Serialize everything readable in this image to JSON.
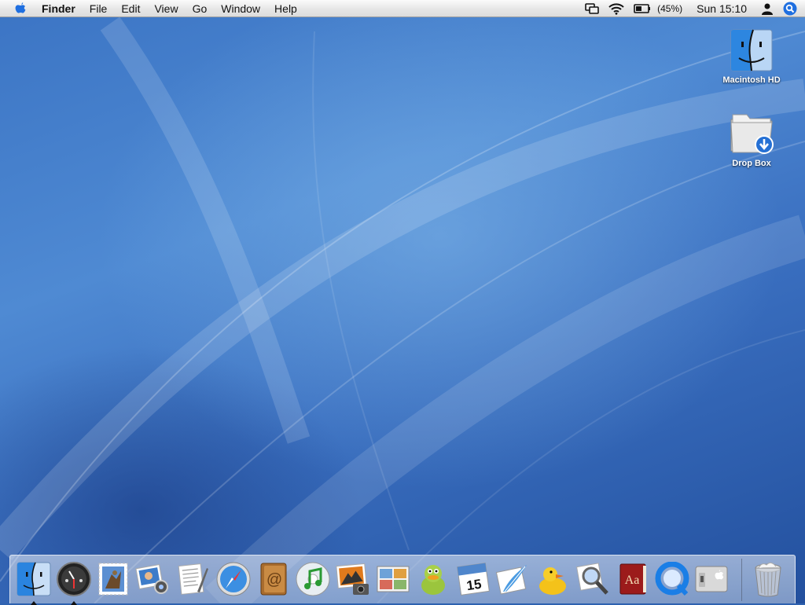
{
  "menubar": {
    "app_name": "Finder",
    "menus": [
      "File",
      "Edit",
      "View",
      "Go",
      "Window",
      "Help"
    ],
    "battery_percent": "(45%)",
    "clock": "Sun 15:10",
    "icons": [
      "apple-icon",
      "display-mirroring-icon",
      "wifi-icon",
      "battery-icon",
      "user-icon",
      "spotlight-icon"
    ]
  },
  "desktop": {
    "items": [
      {
        "label": "Macintosh HD",
        "icon": "finder-face-icon"
      },
      {
        "label": "Drop Box",
        "icon": "dropbox-folder-icon"
      }
    ]
  },
  "dock": {
    "apps": [
      "finder",
      "dashboard",
      "mail",
      "ichat",
      "textedit",
      "safari",
      "address-book",
      "itunes",
      "iphoto",
      "preview",
      "adium",
      "ical",
      "feather",
      "cyberduck",
      "spotlight",
      "dictionary",
      "quicktime",
      "system-preferences"
    ],
    "running": [
      "finder",
      "dashboard"
    ],
    "trash": "trash"
  },
  "colors": {
    "wallpaper": "#3b74c4",
    "spotlight_blue": "#1f6fe0"
  }
}
